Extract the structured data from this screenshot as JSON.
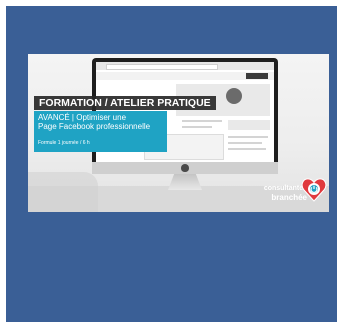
{
  "banner": {
    "title": "FORMATION / ATELIER PRATIQUE",
    "subtitle_line1": "AVANCÉ | Optimiser une",
    "subtitle_line2": "Page Facebook professionnelle",
    "duration": "Formule 1 journée / 6 h"
  },
  "logo": {
    "line1": "consultantes",
    "line2": "branchée",
    "icon": "heart-power-icon",
    "color": "#e03a3e"
  },
  "colors": {
    "frame": "#3a5f96",
    "accent": "#1fa3c4"
  }
}
